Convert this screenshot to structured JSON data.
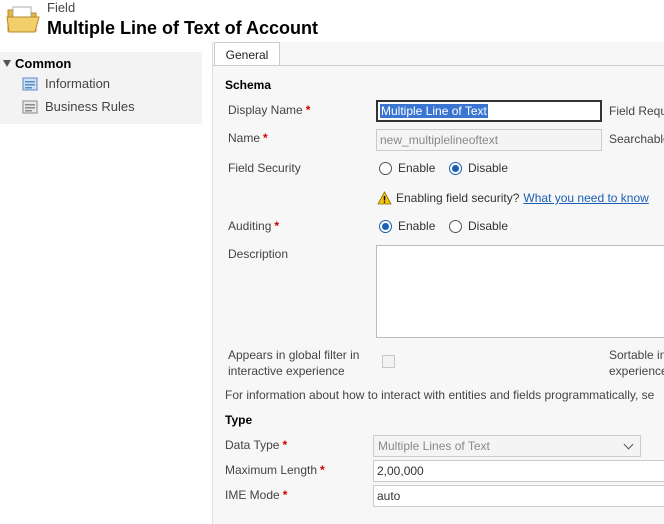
{
  "header": {
    "entity_type": "Field",
    "title": "Multiple Line of Text of Account"
  },
  "nav": {
    "group_label": "Common",
    "items": [
      {
        "label": "Information",
        "icon": "information-icon"
      },
      {
        "label": "Business Rules",
        "icon": "business-rules-icon"
      }
    ]
  },
  "tabs": {
    "general": "General"
  },
  "schema": {
    "title": "Schema",
    "display_name_label": "Display Name",
    "display_name_value": "Multiple Line of Text",
    "field_requirement_label": "Field Requ",
    "name_label": "Name",
    "name_value": "new_multiplelineoftext",
    "searchable_label": "Searchable",
    "field_security_label": "Field Security",
    "enable_label": "Enable",
    "disable_label": "Disable",
    "field_security_selected": "Disable",
    "warning_text": "Enabling field security?",
    "warning_link": "What you need to know",
    "auditing_label": "Auditing",
    "auditing_selected": "Enable",
    "description_label": "Description",
    "global_filter_line1": "Appears in global filter in",
    "global_filter_line2": "interactive experience",
    "sortable_line1": "Sortable in",
    "sortable_line2": "experience",
    "info_text": "For information about how to interact with entities and fields programmatically, se"
  },
  "type": {
    "title": "Type",
    "data_type_label": "Data Type",
    "data_type_value": "Multiple Lines of Text",
    "max_length_label": "Maximum Length",
    "max_length_value": "2,00,000",
    "ime_mode_label": "IME Mode",
    "ime_mode_value": "auto"
  },
  "colors": {
    "required": "#cc0000",
    "link": "#1a5fb4",
    "selection": "#3a76d1"
  }
}
